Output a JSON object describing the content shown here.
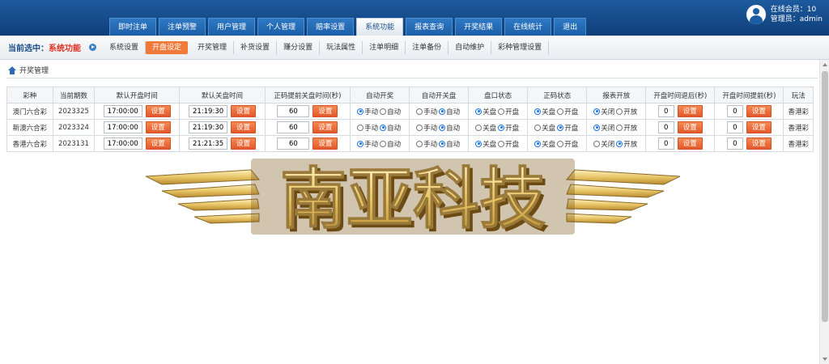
{
  "topnav": [
    "即时注单",
    "注单预警",
    "用户管理",
    "个人管理",
    "赔率设置",
    "系统功能",
    "报表查询",
    "开奖结果",
    "在线统计",
    "退出"
  ],
  "topnav_active": 5,
  "user": {
    "online": "在线会员：10",
    "admin": "管理员：admin"
  },
  "current": {
    "prefix": "当前选中：",
    "section": "系统功能"
  },
  "subnav": [
    "系统设置",
    "开盘设定",
    "开奖管理",
    "补货设置",
    "赚分设置",
    "玩法属性",
    "注单明细",
    "注单备份",
    "自动维护",
    "彩种管理设置"
  ],
  "subnav_active": 1,
  "breadcrumb": "开奖管理",
  "table": {
    "headers": [
      "彩种",
      "当前期数",
      "默认开盘时间",
      "默认关盘时间",
      "正码提前关盘时间(秒)",
      "自动开奖",
      "自动开关盘",
      "盘口状态",
      "正码状态",
      "报表开放",
      "开盘时间退后(秒)",
      "开盘时间提前(秒)",
      "玩法"
    ],
    "set_label": "设置",
    "rows": [
      {
        "name": "澳门六合彩",
        "period": "2023325",
        "open": "17:00:00",
        "close": "21:19:30",
        "advance": "60",
        "auto_draw": [
          "手动",
          "自动"
        ],
        "auto_draw_sel": 0,
        "auto_switch": [
          "手动",
          "自动"
        ],
        "auto_switch_sel": 1,
        "pan": [
          "关盘",
          "开盘"
        ],
        "pan_sel": 0,
        "zhengma": [
          "关盘",
          "开盘"
        ],
        "zhengma_sel": 0,
        "report": [
          "关闭",
          "开放"
        ],
        "report_sel": 0,
        "delay": "0",
        "ahead": "0",
        "play": "香港彩"
      },
      {
        "name": "新澳六合彩",
        "period": "2023324",
        "open": "17:00:00",
        "close": "21:19:30",
        "advance": "60",
        "auto_draw": [
          "手动",
          "自动"
        ],
        "auto_draw_sel": 1,
        "auto_switch": [
          "手动",
          "自动"
        ],
        "auto_switch_sel": 1,
        "pan": [
          "关盘",
          "开盘"
        ],
        "pan_sel": 1,
        "zhengma": [
          "关盘",
          "开盘"
        ],
        "zhengma_sel": 1,
        "report": [
          "关闭",
          "开放"
        ],
        "report_sel": 0,
        "delay": "0",
        "ahead": "0",
        "play": "香港彩"
      },
      {
        "name": "香港六合彩",
        "period": "2023131",
        "open": "17:00:00",
        "close": "21:21:35",
        "advance": "60",
        "auto_draw": [
          "手动",
          "自动"
        ],
        "auto_draw_sel": 0,
        "auto_switch": [
          "手动",
          "自动"
        ],
        "auto_switch_sel": 1,
        "pan": [
          "关盘",
          "开盘"
        ],
        "pan_sel": 0,
        "zhengma": [
          "关盘",
          "开盘"
        ],
        "zhengma_sel": 0,
        "report": [
          "关闭",
          "开放"
        ],
        "report_sel": 1,
        "delay": "0",
        "ahead": "0",
        "play": "香港彩"
      }
    ]
  },
  "watermark": "南亚科技",
  "colors": {
    "header": "#1b5ea6",
    "accent": "#e4582a",
    "current": "#e0301e",
    "radio": "#1a73e8",
    "logo_gold": "#e8c566"
  }
}
